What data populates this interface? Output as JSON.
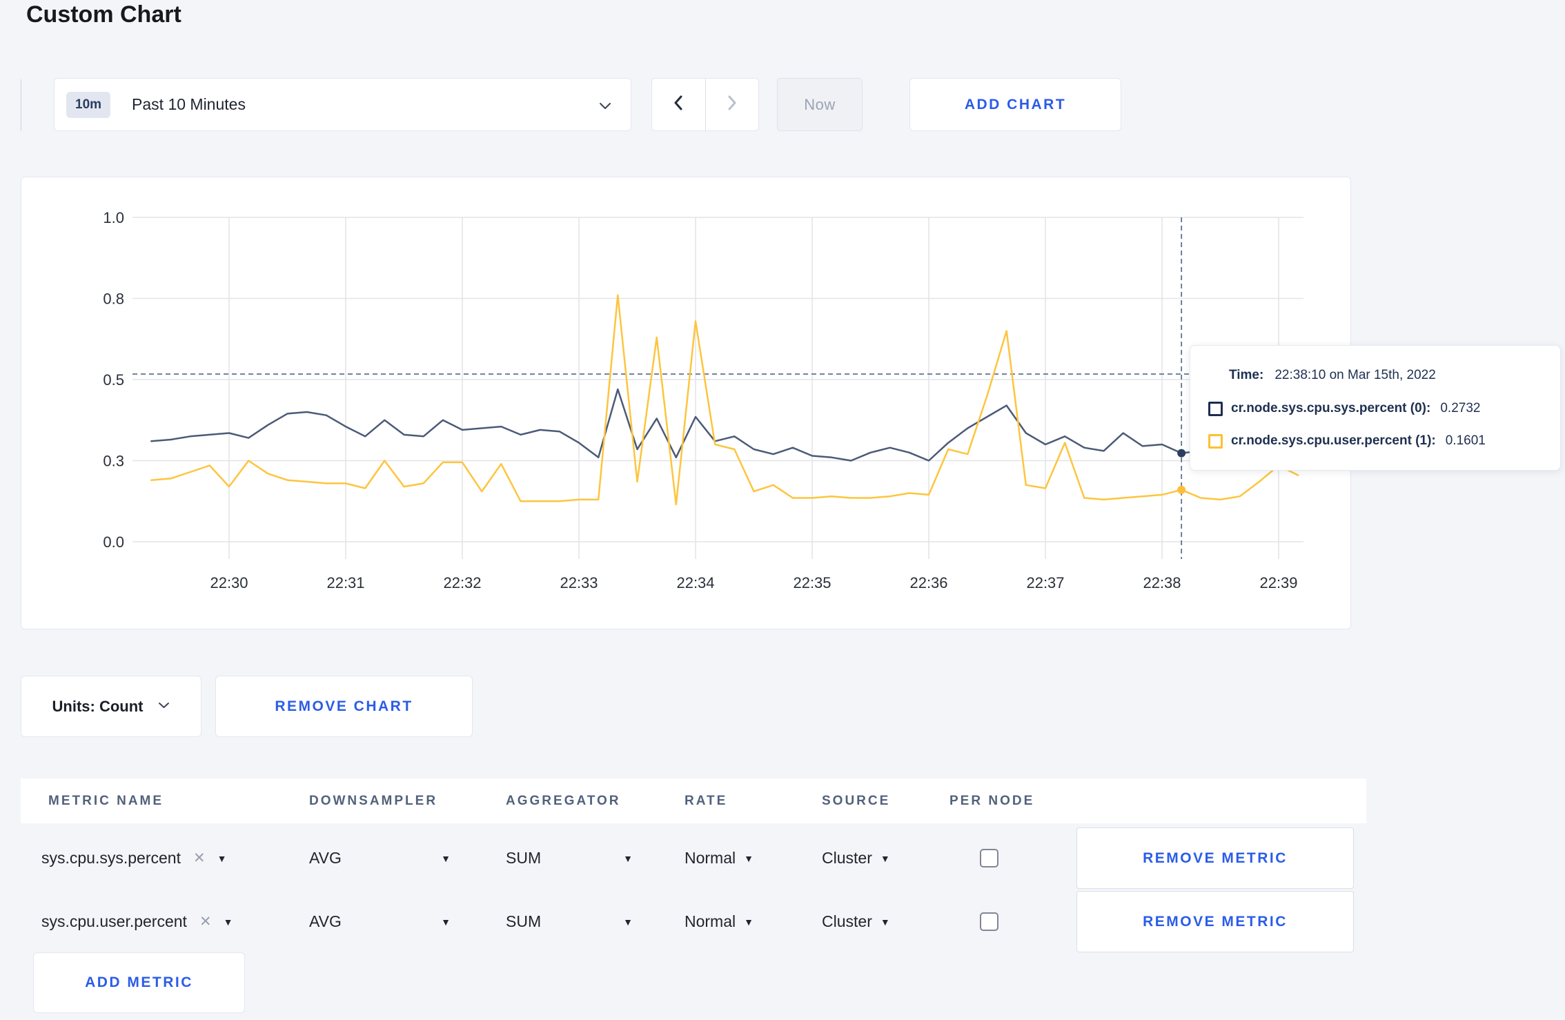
{
  "page": {
    "title": "Custom Chart"
  },
  "toolbar": {
    "time_scale_badge": "10m",
    "time_scale_label": "Past 10 Minutes",
    "now_button": "Now",
    "add_chart_button": "ADD CHART"
  },
  "chart_data": {
    "type": "line",
    "title": "",
    "xlabel": "",
    "ylabel": "",
    "grid": true,
    "x_tick_labels": [
      "22:30",
      "22:31",
      "22:32",
      "22:33",
      "22:34",
      "22:35",
      "22:36",
      "22:37",
      "22:38",
      "22:39"
    ],
    "y_axis": {
      "range": [
        0,
        1
      ],
      "tick_values": [
        0,
        0.25,
        0.5,
        0.75,
        1
      ],
      "tick_labels": [
        "0.0",
        "0.3",
        "0.5",
        "0.8",
        "1.0"
      ]
    },
    "sample_interval_seconds": 10,
    "first_sample_time": "22:29:20",
    "series": [
      {
        "name": "cr.node.sys.cpu.sys.percent (0)",
        "color": "#4b5a77",
        "dot_color": "#2c3e5f",
        "values": [
          0.31,
          0.315,
          0.325,
          0.33,
          0.335,
          0.32,
          0.36,
          0.395,
          0.4,
          0.39,
          0.355,
          0.325,
          0.375,
          0.33,
          0.325,
          0.375,
          0.345,
          0.35,
          0.355,
          0.33,
          0.345,
          0.34,
          0.305,
          0.26,
          0.47,
          0.285,
          0.38,
          0.26,
          0.385,
          0.31,
          0.325,
          0.285,
          0.27,
          0.29,
          0.265,
          0.26,
          0.25,
          0.275,
          0.29,
          0.275,
          0.25,
          0.305,
          0.35,
          0.385,
          0.42,
          0.335,
          0.3,
          0.325,
          0.29,
          0.28,
          0.335,
          0.295,
          0.3,
          0.2732,
          0.28,
          0.27,
          0.275,
          0.29,
          0.315,
          0.31
        ]
      },
      {
        "name": "cr.node.sys.cpu.user.percent (1)",
        "color": "#fdc53e",
        "dot_color": "#ffbe37",
        "values": [
          0.19,
          0.195,
          0.215,
          0.235,
          0.17,
          0.25,
          0.21,
          0.19,
          0.185,
          0.18,
          0.18,
          0.165,
          0.25,
          0.17,
          0.18,
          0.245,
          0.245,
          0.155,
          0.24,
          0.125,
          0.125,
          0.125,
          0.13,
          0.13,
          0.76,
          0.185,
          0.63,
          0.115,
          0.68,
          0.3,
          0.285,
          0.155,
          0.175,
          0.135,
          0.135,
          0.14,
          0.135,
          0.135,
          0.14,
          0.15,
          0.145,
          0.285,
          0.27,
          0.45,
          0.65,
          0.175,
          0.165,
          0.305,
          0.135,
          0.13,
          0.135,
          0.14,
          0.145,
          0.1601,
          0.135,
          0.13,
          0.14,
          0.185,
          0.235,
          0.205
        ]
      }
    ],
    "crosshair": {
      "sample_index": 53,
      "hline_value": 0.517,
      "color": "#5d7191"
    },
    "tooltip": {
      "time_label": "Time:",
      "time_value": "22:38:10 on Mar 15th, 2022",
      "series_rows": [
        {
          "label": "cr.node.sys.cpu.sys.percent (0):",
          "value": "0.2732",
          "swatch_color": "#1c2d4e"
        },
        {
          "label": "cr.node.sys.cpu.user.percent (1):",
          "value": "0.1601",
          "swatch_color": "#ffc02e"
        }
      ]
    }
  },
  "units_bar": {
    "units_label": "Units: Count",
    "remove_chart_button": "REMOVE CHART"
  },
  "metrics_table": {
    "headers": [
      "METRIC NAME",
      "DOWNSAMPLER",
      "AGGREGATOR",
      "RATE",
      "SOURCE",
      "PER NODE"
    ],
    "rows": [
      {
        "metric_name": "sys.cpu.sys.percent",
        "downsampler": "AVG",
        "aggregator": "SUM",
        "rate": "Normal",
        "source": "Cluster",
        "per_node_checked": false,
        "remove_button": "REMOVE METRIC"
      },
      {
        "metric_name": "sys.cpu.user.percent",
        "downsampler": "AVG",
        "aggregator": "SUM",
        "rate": "Normal",
        "source": "Cluster",
        "per_node_checked": false,
        "remove_button": "REMOVE METRIC"
      }
    ],
    "add_metric_button": "ADD METRIC"
  },
  "colors": {
    "accent_blue": "#2b5ce8",
    "page_background": "#f4f5f9"
  }
}
